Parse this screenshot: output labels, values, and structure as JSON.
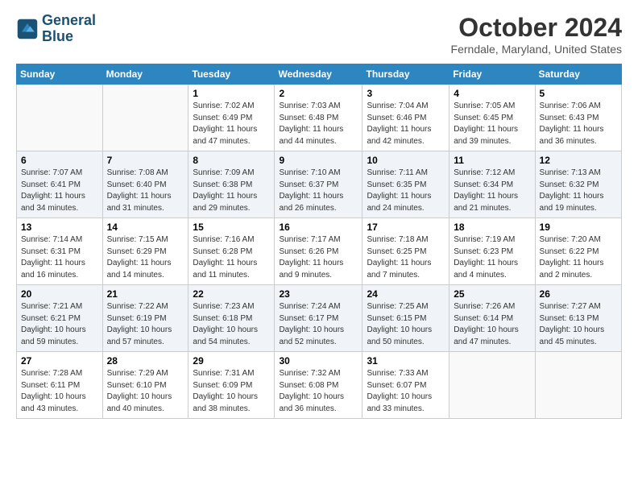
{
  "header": {
    "logo_line1": "General",
    "logo_line2": "Blue",
    "month": "October 2024",
    "location": "Ferndale, Maryland, United States"
  },
  "days_of_week": [
    "Sunday",
    "Monday",
    "Tuesday",
    "Wednesday",
    "Thursday",
    "Friday",
    "Saturday"
  ],
  "weeks": [
    [
      {
        "day": "",
        "info": ""
      },
      {
        "day": "",
        "info": ""
      },
      {
        "day": "1",
        "info": "Sunrise: 7:02 AM\nSunset: 6:49 PM\nDaylight: 11 hours and 47 minutes."
      },
      {
        "day": "2",
        "info": "Sunrise: 7:03 AM\nSunset: 6:48 PM\nDaylight: 11 hours and 44 minutes."
      },
      {
        "day": "3",
        "info": "Sunrise: 7:04 AM\nSunset: 6:46 PM\nDaylight: 11 hours and 42 minutes."
      },
      {
        "day": "4",
        "info": "Sunrise: 7:05 AM\nSunset: 6:45 PM\nDaylight: 11 hours and 39 minutes."
      },
      {
        "day": "5",
        "info": "Sunrise: 7:06 AM\nSunset: 6:43 PM\nDaylight: 11 hours and 36 minutes."
      }
    ],
    [
      {
        "day": "6",
        "info": "Sunrise: 7:07 AM\nSunset: 6:41 PM\nDaylight: 11 hours and 34 minutes."
      },
      {
        "day": "7",
        "info": "Sunrise: 7:08 AM\nSunset: 6:40 PM\nDaylight: 11 hours and 31 minutes."
      },
      {
        "day": "8",
        "info": "Sunrise: 7:09 AM\nSunset: 6:38 PM\nDaylight: 11 hours and 29 minutes."
      },
      {
        "day": "9",
        "info": "Sunrise: 7:10 AM\nSunset: 6:37 PM\nDaylight: 11 hours and 26 minutes."
      },
      {
        "day": "10",
        "info": "Sunrise: 7:11 AM\nSunset: 6:35 PM\nDaylight: 11 hours and 24 minutes."
      },
      {
        "day": "11",
        "info": "Sunrise: 7:12 AM\nSunset: 6:34 PM\nDaylight: 11 hours and 21 minutes."
      },
      {
        "day": "12",
        "info": "Sunrise: 7:13 AM\nSunset: 6:32 PM\nDaylight: 11 hours and 19 minutes."
      }
    ],
    [
      {
        "day": "13",
        "info": "Sunrise: 7:14 AM\nSunset: 6:31 PM\nDaylight: 11 hours and 16 minutes."
      },
      {
        "day": "14",
        "info": "Sunrise: 7:15 AM\nSunset: 6:29 PM\nDaylight: 11 hours and 14 minutes."
      },
      {
        "day": "15",
        "info": "Sunrise: 7:16 AM\nSunset: 6:28 PM\nDaylight: 11 hours and 11 minutes."
      },
      {
        "day": "16",
        "info": "Sunrise: 7:17 AM\nSunset: 6:26 PM\nDaylight: 11 hours and 9 minutes."
      },
      {
        "day": "17",
        "info": "Sunrise: 7:18 AM\nSunset: 6:25 PM\nDaylight: 11 hours and 7 minutes."
      },
      {
        "day": "18",
        "info": "Sunrise: 7:19 AM\nSunset: 6:23 PM\nDaylight: 11 hours and 4 minutes."
      },
      {
        "day": "19",
        "info": "Sunrise: 7:20 AM\nSunset: 6:22 PM\nDaylight: 11 hours and 2 minutes."
      }
    ],
    [
      {
        "day": "20",
        "info": "Sunrise: 7:21 AM\nSunset: 6:21 PM\nDaylight: 10 hours and 59 minutes."
      },
      {
        "day": "21",
        "info": "Sunrise: 7:22 AM\nSunset: 6:19 PM\nDaylight: 10 hours and 57 minutes."
      },
      {
        "day": "22",
        "info": "Sunrise: 7:23 AM\nSunset: 6:18 PM\nDaylight: 10 hours and 54 minutes."
      },
      {
        "day": "23",
        "info": "Sunrise: 7:24 AM\nSunset: 6:17 PM\nDaylight: 10 hours and 52 minutes."
      },
      {
        "day": "24",
        "info": "Sunrise: 7:25 AM\nSunset: 6:15 PM\nDaylight: 10 hours and 50 minutes."
      },
      {
        "day": "25",
        "info": "Sunrise: 7:26 AM\nSunset: 6:14 PM\nDaylight: 10 hours and 47 minutes."
      },
      {
        "day": "26",
        "info": "Sunrise: 7:27 AM\nSunset: 6:13 PM\nDaylight: 10 hours and 45 minutes."
      }
    ],
    [
      {
        "day": "27",
        "info": "Sunrise: 7:28 AM\nSunset: 6:11 PM\nDaylight: 10 hours and 43 minutes."
      },
      {
        "day": "28",
        "info": "Sunrise: 7:29 AM\nSunset: 6:10 PM\nDaylight: 10 hours and 40 minutes."
      },
      {
        "day": "29",
        "info": "Sunrise: 7:31 AM\nSunset: 6:09 PM\nDaylight: 10 hours and 38 minutes."
      },
      {
        "day": "30",
        "info": "Sunrise: 7:32 AM\nSunset: 6:08 PM\nDaylight: 10 hours and 36 minutes."
      },
      {
        "day": "31",
        "info": "Sunrise: 7:33 AM\nSunset: 6:07 PM\nDaylight: 10 hours and 33 minutes."
      },
      {
        "day": "",
        "info": ""
      },
      {
        "day": "",
        "info": ""
      }
    ]
  ]
}
